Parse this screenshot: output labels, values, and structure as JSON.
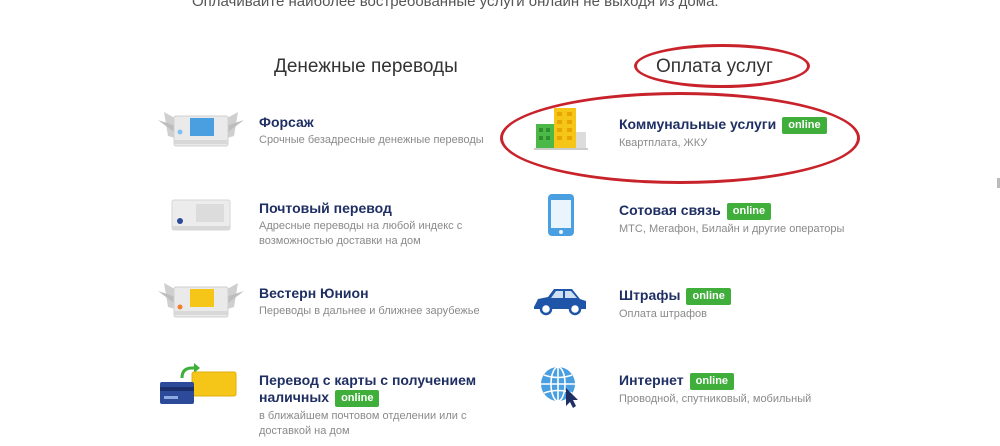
{
  "tagline": "Оплачивайте наиболее востребованные услуги онлайн не выходя из дома.",
  "columns": {
    "left_title": "Денежные переводы",
    "right_title": "Оплата услуг"
  },
  "transfers": [
    {
      "title": "Форсаж",
      "subtitle": "Срочные безадресные денежные переводы",
      "icon": "winged-terminal-blue-icon"
    },
    {
      "title": "Почтовый перевод",
      "subtitle": "Адресные переводы на любой индекс с возможностью доставки на дом",
      "icon": "postal-transfer-icon"
    },
    {
      "title": "Вестерн Юнион",
      "subtitle": "Переводы в дальнее и ближнее зарубежье",
      "icon": "winged-terminal-yellow-icon"
    },
    {
      "title": "Перевод с карты с получением наличных",
      "badge": "online",
      "subtitle": "в ближайшем почтовом отделении или с доставкой на дом",
      "icon": "card-to-cash-icon"
    }
  ],
  "services": [
    {
      "title": "Коммунальные услуги",
      "badge": "online",
      "subtitle": "Квартплата, ЖКУ",
      "icon": "building-icon"
    },
    {
      "title": "Сотовая связь",
      "badge": "online",
      "subtitle": "МТС, Мегафон, Билайн и другие операторы",
      "icon": "smartphone-icon"
    },
    {
      "title": "Штрафы",
      "badge": "online",
      "subtitle": "Оплата штрафов",
      "icon": "car-icon"
    },
    {
      "title": "Интернет",
      "badge": "online",
      "subtitle": "Проводной, спутниковый, мобильный",
      "icon": "globe-cursor-icon"
    }
  ],
  "colors": {
    "title": "#1f2f63",
    "badge": "#3fae3a",
    "annotation": "#c8232b"
  }
}
